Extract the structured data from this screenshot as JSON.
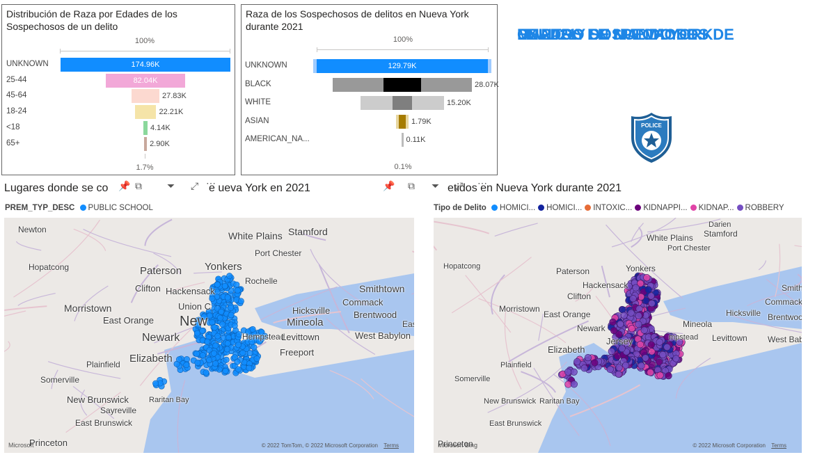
{
  "dashboard_title": [
    "CUADRO DE MANDO DE",
    "MAPAS Y SOSPECHOSOS DE",
    "DELITOS EN NUEVA YORK",
    "EN 2021"
  ],
  "badge_text": "POLICE",
  "funnel_age": {
    "title_lines": [
      "Distribución de Raza por Edades de los",
      "Sospechosos de un delito"
    ],
    "top_pct": "100%",
    "bottom_pct": "1.7%",
    "rows": [
      {
        "label": "UNKNOWN",
        "value": "174.96K",
        "fraction": 1.0,
        "color": "#118dff"
      },
      {
        "label": "25-44",
        "value": "82.04K",
        "fraction": 0.469,
        "color": "#f2a8d8"
      },
      {
        "label": "45-64",
        "value": "27.83K",
        "fraction": 0.159,
        "color": "#fcd9d0"
      },
      {
        "label": "18-24",
        "value": "22.21K",
        "fraction": 0.127,
        "color": "#f5e4a8"
      },
      {
        "label": "<18",
        "value": "4.14K",
        "fraction": 0.024,
        "color": "#8bd89c"
      },
      {
        "label": "65+",
        "value": "2.90K",
        "fraction": 0.017,
        "color": "#c8a89c"
      }
    ]
  },
  "funnel_race": {
    "title_lines": [
      "Raza de los Sospechosos de delitos en Nueva York",
      "durante 2021"
    ],
    "top_pct": "100%",
    "bottom_pct": "0.1%",
    "rows": [
      {
        "label": "UNKNOWN",
        "value": "129.79K",
        "fraction": 1.0,
        "color": "#118dff"
      },
      {
        "label": "BLACK",
        "value": "28.07K",
        "fraction": 0.216,
        "color": "#000000"
      },
      {
        "label": "WHITE",
        "value": "15.20K",
        "fraction": 0.117,
        "color": "#7f7f7f"
      },
      {
        "label": "ASIAN",
        "value": "1.79K",
        "fraction": 0.014,
        "color": "#a67c00"
      },
      {
        "label": "AMERICAN_NA...",
        "value": "0.11K",
        "fraction": 0.001,
        "color": "#bbbbbb"
      }
    ]
  },
  "map_left": {
    "title": "Lugares donde se co",
    "title_tail": "e    ueva York en 2021",
    "legend_field": "PREM_TYP_DESC",
    "legend_items": [
      {
        "label": "PUBLIC SCHOOL",
        "color": "#118dff"
      }
    ],
    "copyright": "© 2022 TomTom, © 2022 Microsoft Corporation",
    "terms": "Terms",
    "brand": "Microsoft",
    "places": [
      "Newton",
      "Hopatcong",
      "Paterson",
      "Yonkers",
      "White Plains",
      "Stamford",
      "Port Chester",
      "Clifton",
      "Hackensack",
      "Rochelle",
      "Morristown",
      "Union C",
      "East Orange",
      "New",
      "Mineola",
      "Hicksville",
      "Commack",
      "Smithtown",
      "Brentwood",
      "Newark",
      "Hempstead",
      "Levittown",
      "West Babylon",
      "Freeport",
      "Elizabeth",
      "Plainfield",
      "Somerville",
      "New Brunswick",
      "Sayreville",
      "East Brunswick",
      "Raritan Bay",
      "Princeton",
      "Eas"
    ]
  },
  "map_right": {
    "title": "etidos en Nueva York durante 2021",
    "legend_field": "Tipo de Delito",
    "legend_items": [
      {
        "label": "HOMICI...",
        "color": "#118dff"
      },
      {
        "label": "HOMICI...",
        "color": "#12239e"
      },
      {
        "label": "INTOXIC...",
        "color": "#e66c37"
      },
      {
        "label": "KIDNAPPI...",
        "color": "#6b007b"
      },
      {
        "label": "KIDNAP...",
        "color": "#e044a7"
      },
      {
        "label": "ROBBERY",
        "color": "#744ec2"
      }
    ],
    "copyright": "© 2022 Microsoft Corporation",
    "terms": "Terms",
    "brand": "Microsoft Bing",
    "places": [
      "Darien",
      "Stamford",
      "White Plains",
      "Port Chester",
      "Hopatcong",
      "Paterson",
      "Yonkers",
      "Hackensack",
      "Clifton",
      "Smithto",
      "Commack",
      "Morristown",
      "East Orange",
      "Hicksville",
      "Brentwood",
      "Newark",
      "Mineola",
      "Jersey",
      "mpstead",
      "Levittown",
      "West Babylo",
      "Elizabeth",
      "Plainfield",
      "Somerville",
      "New Brunswick",
      "Raritan Bay",
      "East Brunswick",
      "Princeton"
    ]
  },
  "colors": {
    "accent": "#1e86e6",
    "water": "#a9c6ef",
    "land": "#ece9e6"
  }
}
